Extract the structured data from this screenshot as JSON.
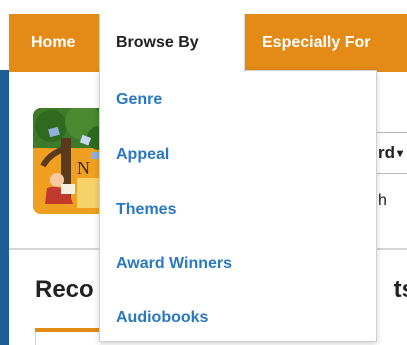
{
  "nav": {
    "items": [
      {
        "label": "Home"
      },
      {
        "label": "Browse By"
      },
      {
        "label": "Especially For"
      }
    ],
    "brand_color": "#e38a17"
  },
  "dropdown": {
    "items": [
      {
        "label": "Genre"
      },
      {
        "label": "Appeal"
      },
      {
        "label": "Themes"
      },
      {
        "label": "Award Winners"
      },
      {
        "label": "Audiobooks"
      }
    ],
    "link_color": "#2b78c2"
  },
  "search": {
    "field_selected_partial": "rd",
    "hint_partial": "h"
  },
  "section": {
    "heading_left_partial": "Reco",
    "heading_right_partial": "ts"
  }
}
